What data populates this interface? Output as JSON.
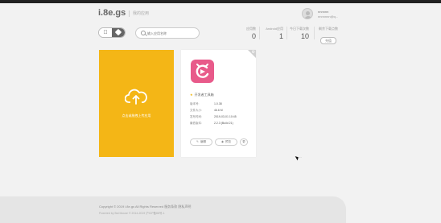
{
  "header": {
    "logo": "i.8e.gs",
    "nav_link": "我的应用",
    "user_name": "nnnnnn",
    "user_email": "nnnnnnn@q..."
  },
  "toolbar": {
    "platform_apple_icon": "apple-icon",
    "platform_android_icon": "android-icon",
    "search_placeholder": "输入应用名称"
  },
  "stats": {
    "labels": [
      "应用数",
      "Android应用",
      "今日下载次数",
      "剩余下载点数"
    ],
    "values": [
      "0",
      "1",
      "10"
    ],
    "recharge": "充值"
  },
  "upload_card": {
    "label": "点击或拖拽上传应用"
  },
  "app_card": {
    "name": "开发者工具箱",
    "rows": [
      {
        "label": "版本号:",
        "value": "1.0.38"
      },
      {
        "label": "文件大小:",
        "value": "46.6 M"
      },
      {
        "label": "发布时间:",
        "value": "2019-03-01 10:45"
      },
      {
        "label": "最低版本:",
        "value": "2.2.3 (Build 21)"
      }
    ],
    "buttons": {
      "edit": "编辑",
      "preview": "预览",
      "more": "更"
    },
    "accent": "#e85a8a"
  },
  "footer": {
    "line1": "Copyright © 2019 i.8e.gs All Rights Reserved    服务条款  隐私声明",
    "line2": "Powered by Bai Mouse  © 2014-2019 沪ICP备88号-1"
  },
  "colors": {
    "upload_card_bg": "#f4b616",
    "topbar": "#222222"
  }
}
